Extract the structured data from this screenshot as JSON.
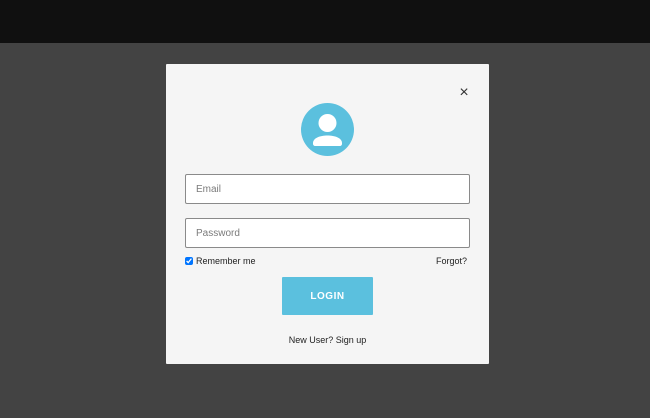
{
  "login_modal": {
    "close_symbol": "×",
    "avatar_icon": "user-avatar-icon",
    "email_placeholder": "Email",
    "email_value": "",
    "password_placeholder": "Password",
    "password_value": "",
    "remember_label": "Remember me",
    "remember_checked": true,
    "forgot_label": "Forgot?",
    "login_label": "LOGIN",
    "signup_label": "New User? Sign up"
  },
  "colors": {
    "topbar": "#101010",
    "backdrop": "#434343",
    "modal_bg": "#f5f5f5",
    "accent": "#5bc0de"
  }
}
